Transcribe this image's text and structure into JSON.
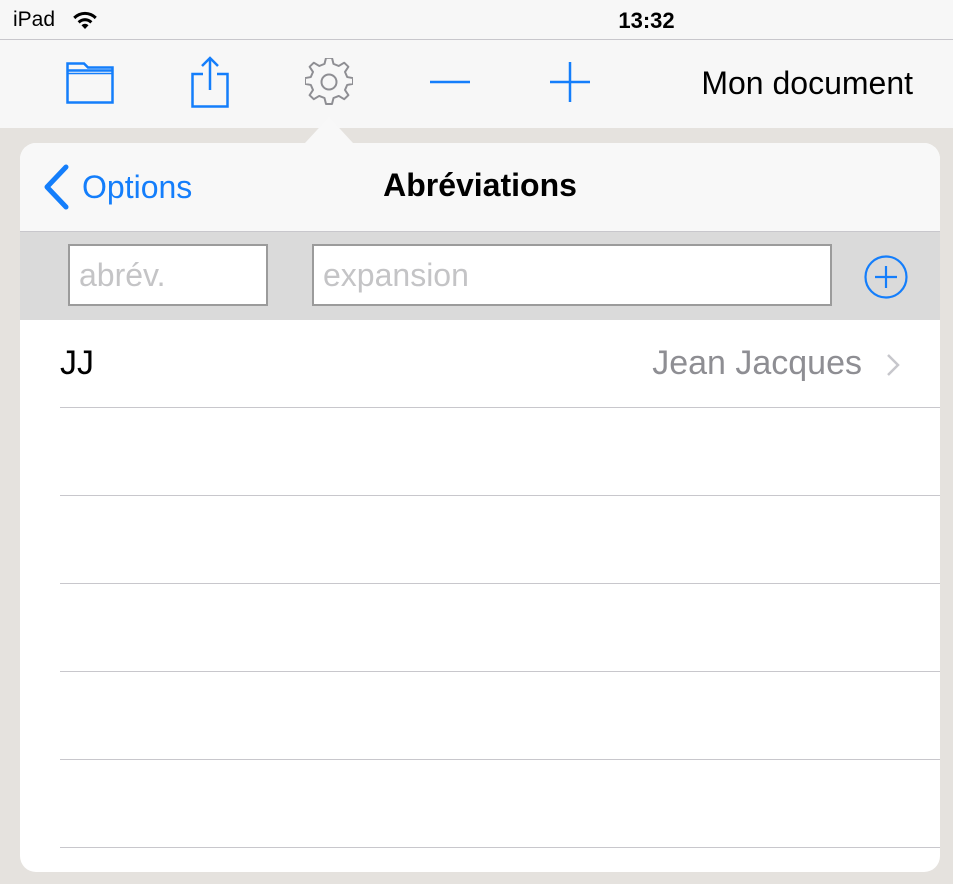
{
  "status_bar": {
    "device": "iPad",
    "time": "13:32",
    "wifi_icon": "wifi-icon"
  },
  "toolbar": {
    "icons": [
      "folder-icon",
      "share-icon",
      "gear-icon",
      "minus-icon",
      "plus-icon"
    ],
    "document_title": "Mon document"
  },
  "popover": {
    "back_label": "Options",
    "title": "Abréviations",
    "abbr_placeholder": "abrév.",
    "expansion_placeholder": "expansion",
    "add_icon": "plus-circle-icon"
  },
  "abbreviations": [
    {
      "abbr": "JJ",
      "expansion": "Jean Jacques"
    }
  ],
  "colors": {
    "accent": "#147efb",
    "secondary_text": "#8e8e93",
    "background": "#e5e2de"
  }
}
